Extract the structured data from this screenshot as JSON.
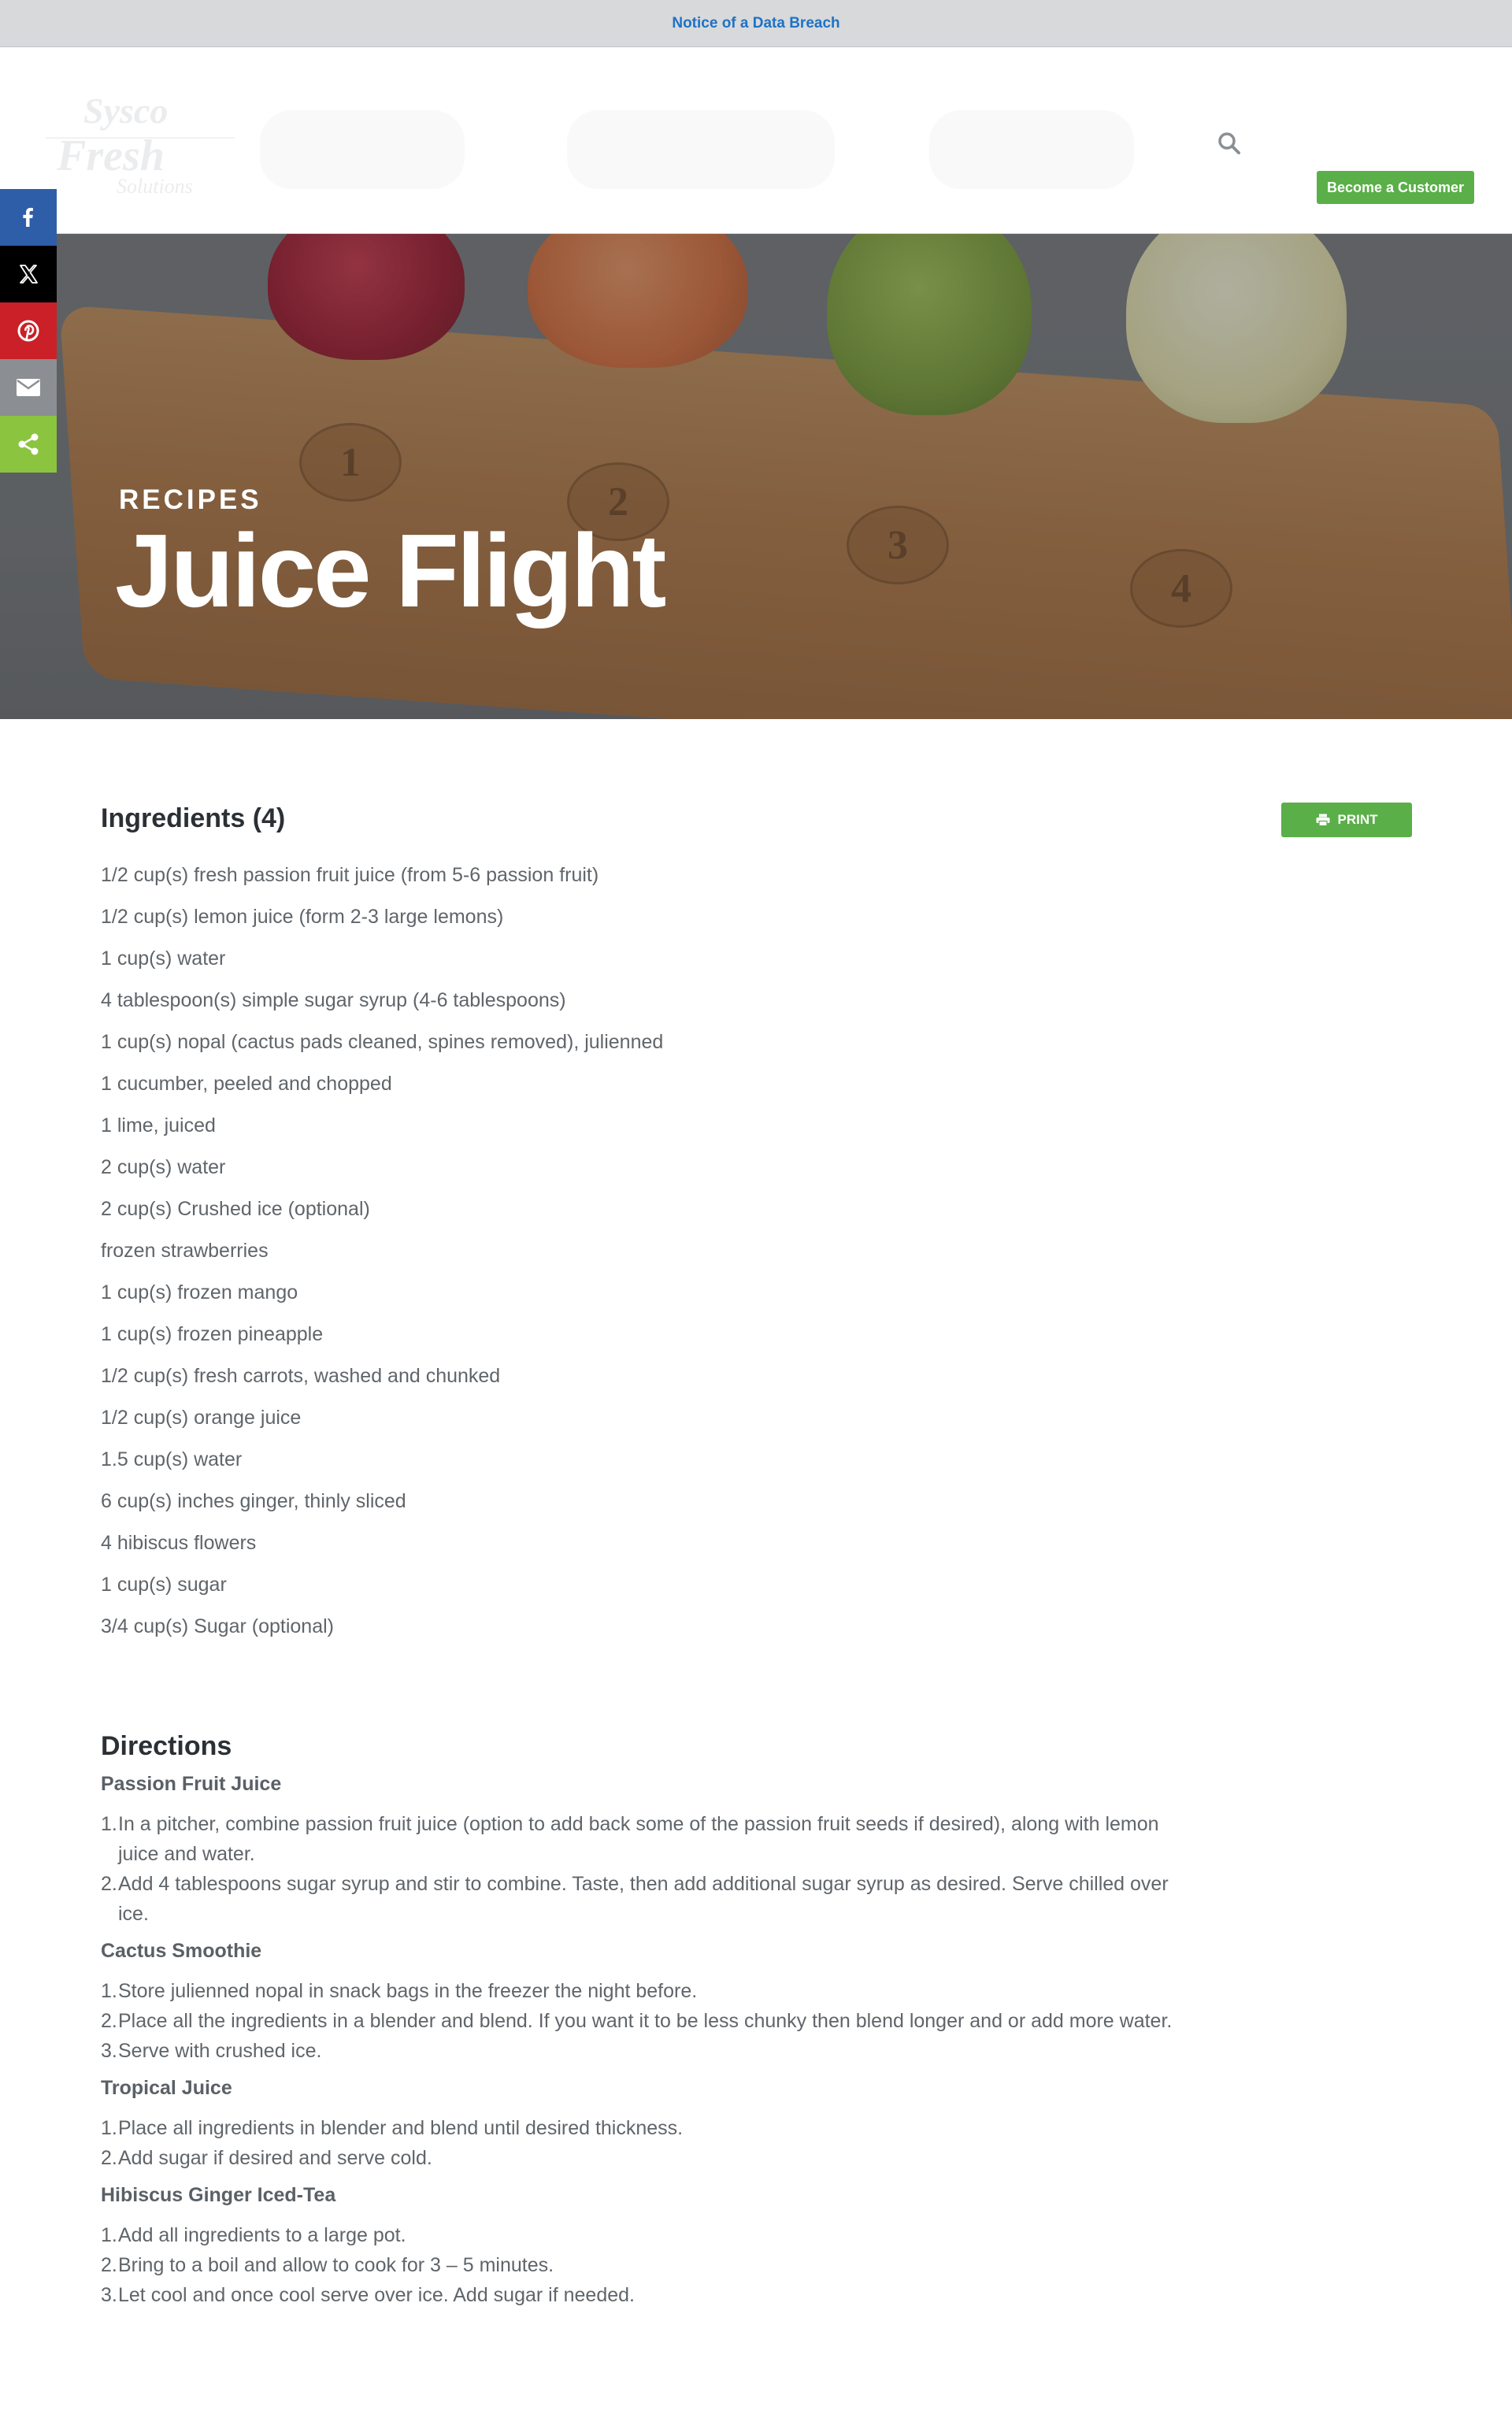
{
  "notice": {
    "text": "Notice of a Data Breach"
  },
  "header": {
    "logo": {
      "line1": "Sysco",
      "line2": "Fresh",
      "line3": "Solutions"
    },
    "search_icon": "search-icon",
    "cta_label": "Become a Customer",
    "cta_color": "#5aaf48"
  },
  "share": {
    "items": [
      {
        "name": "facebook",
        "icon": "facebook-icon",
        "color": "#2f5ea8"
      },
      {
        "name": "x",
        "icon": "x-icon",
        "color": "#000000"
      },
      {
        "name": "pinterest",
        "icon": "pinterest-icon",
        "color": "#cb2027"
      },
      {
        "name": "email",
        "icon": "mail-icon",
        "color": "#8b8f93"
      },
      {
        "name": "share",
        "icon": "share-icon",
        "color": "#8bc43f"
      }
    ]
  },
  "hero": {
    "eyebrow": "RECIPES",
    "title": "Juice Flight",
    "slot_numbers": [
      "1",
      "2",
      "3",
      "4"
    ]
  },
  "ingredients": {
    "heading": "Ingredients (4)",
    "print_label": "PRINT",
    "items": [
      "1/2 cup(s) fresh passion fruit juice (from 5-6 passion fruit)",
      "1/2 cup(s) lemon juice (form 2-3 large lemons)",
      "1 cup(s) water",
      "4 tablespoon(s) simple sugar syrup (4-6 tablespoons)",
      "1 cup(s) nopal (cactus pads cleaned, spines removed), julienned",
      "1 cucumber, peeled and chopped",
      "1 lime, juiced",
      "2 cup(s) water",
      "2 cup(s) Crushed ice (optional)",
      "frozen strawberries",
      "1 cup(s) frozen mango",
      "1 cup(s) frozen pineapple",
      "1/2 cup(s) fresh carrots, washed and chunked",
      "1/2 cup(s) orange juice",
      "1.5 cup(s) water",
      "6 cup(s) inches ginger, thinly sliced",
      "4 hibiscus flowers",
      "1 cup(s) sugar",
      "3/4 cup(s) Sugar (optional)"
    ]
  },
  "directions": {
    "heading": "Directions",
    "groups": [
      {
        "title": "Passion Fruit Juice",
        "steps": [
          "In a pitcher, combine passion fruit juice (option to add back some of the passion fruit seeds if desired), along with lemon juice and water.",
          "Add 4 tablespoons sugar syrup and stir to combine. Taste, then add additional sugar syrup as desired. Serve chilled over ice."
        ]
      },
      {
        "title": "Cactus Smoothie",
        "steps": [
          "Store julienned nopal in snack bags in the freezer the night before.",
          "Place all the ingredients in a blender and blend. If you want it to be less chunky then blend longer and or add more water.",
          "Serve with crushed ice."
        ]
      },
      {
        "title": "Tropical Juice",
        "steps": [
          "Place all ingredients in blender and blend until desired thickness.",
          "Add sugar if desired and serve cold."
        ]
      },
      {
        "title": "Hibiscus Ginger Iced-Tea",
        "steps": [
          "Add all ingredients to a large pot.",
          "Bring to a boil and allow to cook for 3 – 5 minutes.",
          "Let cool and once cool serve over ice. Add sugar if needed."
        ]
      }
    ]
  }
}
